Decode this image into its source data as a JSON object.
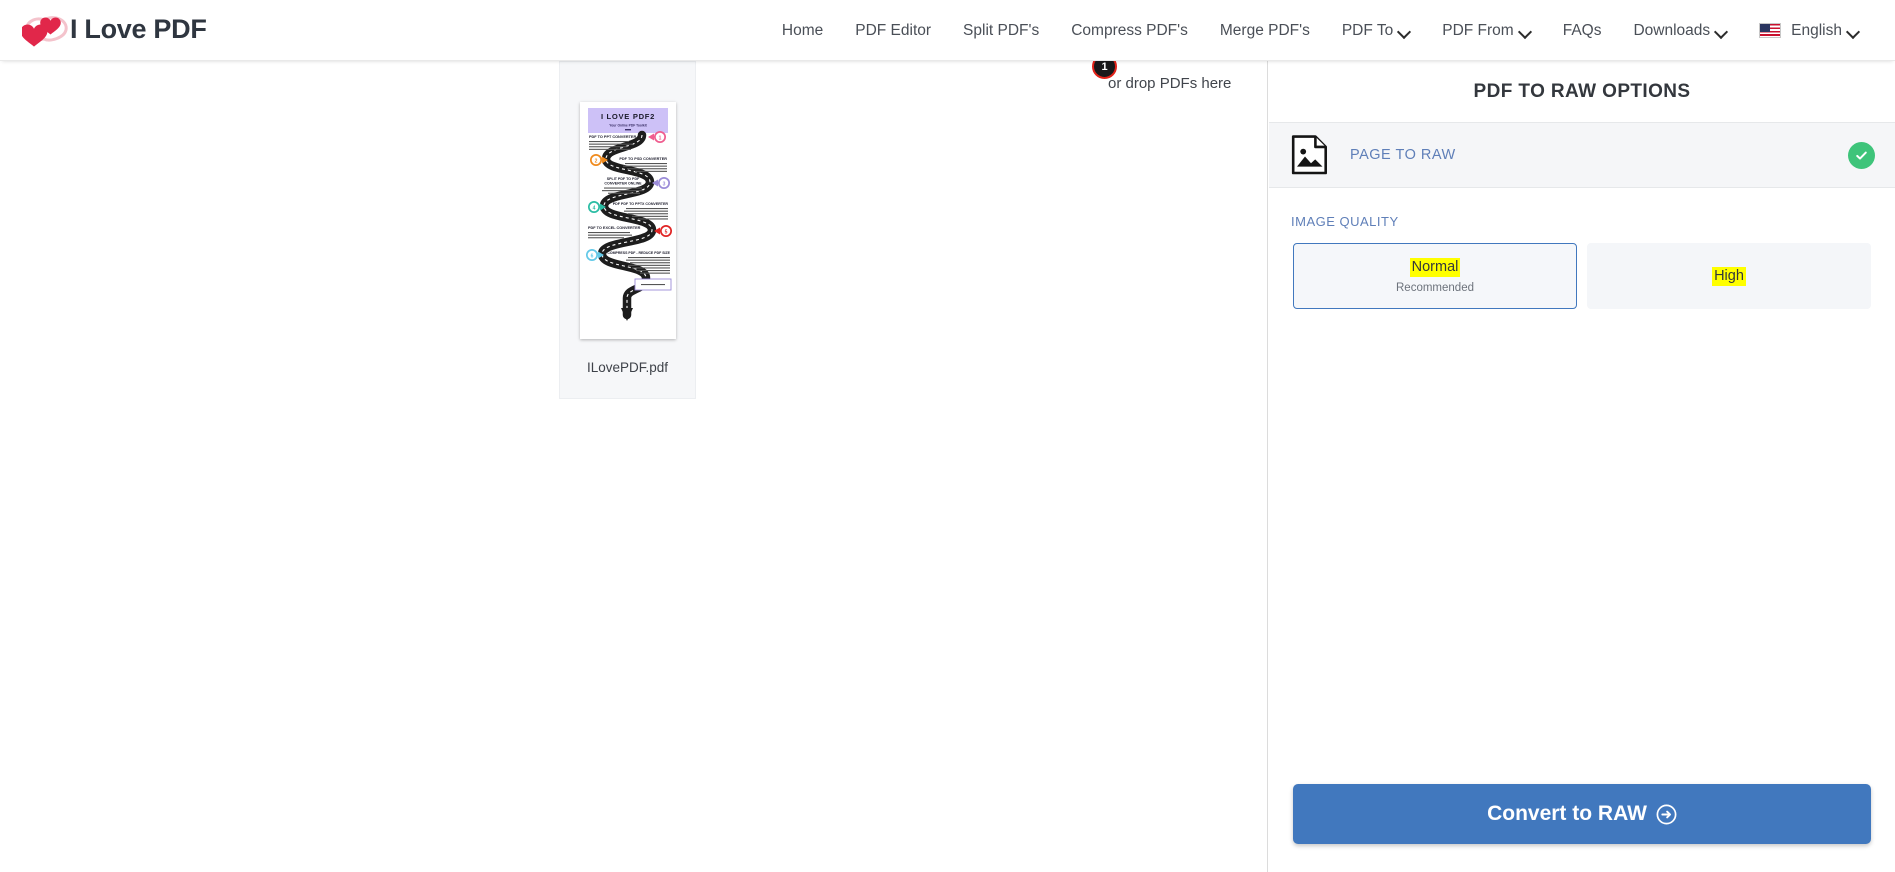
{
  "header": {
    "brand_name": "I Love PDF",
    "logo_icon": "two-hearts-logo",
    "nav": [
      {
        "label": "Home",
        "has_caret": false
      },
      {
        "label": "PDF Editor",
        "has_caret": false
      },
      {
        "label": "Split PDF's",
        "has_caret": false
      },
      {
        "label": "Compress PDF's",
        "has_caret": false
      },
      {
        "label": "Merge PDF's",
        "has_caret": false
      },
      {
        "label": "PDF To",
        "has_caret": true
      },
      {
        "label": "PDF From",
        "has_caret": true
      },
      {
        "label": "FAQs",
        "has_caret": false
      },
      {
        "label": "Downloads",
        "has_caret": true
      }
    ],
    "language": {
      "label": "English",
      "flag": "us-flag-icon",
      "has_caret": true
    }
  },
  "workspace": {
    "drop_hint": "or drop PDFs here",
    "file_count_badge": "1",
    "file": {
      "name": "ILovePDF.pdf",
      "thumbnail": {
        "title": "I LOVE PDF2",
        "subtitle": "Your Online PDF Toolkit",
        "steps": [
          {
            "number": "1",
            "heading": "PDF TO PPT CONVERTER",
            "color": "#ef5d8f"
          },
          {
            "number": "2",
            "heading": "PDF TO PSD CONVERTER",
            "color": "#f08a1c"
          },
          {
            "number": "3",
            "heading": "SPLIT PDF TO PDF CONVERTER ONLINE",
            "color": "#9b8cd8"
          },
          {
            "number": "4",
            "heading": "PDF PDF TO PPTX CONVERTER",
            "color": "#2bbda4"
          },
          {
            "number": "5",
            "heading": "PDF TO EXCEL CONVERTER",
            "color": "#e02424"
          },
          {
            "number": "6",
            "heading": "COMPRESS PDF - REDUCE PDF SIZE",
            "color": "#63c9e8"
          }
        ]
      }
    }
  },
  "panel": {
    "title": "PDF TO RAW OPTIONS",
    "tool": {
      "label": "PAGE TO RAW",
      "icon": "document-image-icon",
      "status_icon": "check-circle-icon",
      "status_color": "#3ec47a"
    },
    "image_quality": {
      "section_label": "IMAGE QUALITY",
      "options": [
        {
          "title": "Normal",
          "subtitle": "Recommended",
          "selected": true
        },
        {
          "title": "High",
          "subtitle": "",
          "selected": false
        }
      ]
    },
    "convert_button": {
      "label": "Convert to RAW",
      "icon": "arrow-right-circle-icon"
    },
    "accent_color": "#4178be",
    "highlight_color": "#ffff00"
  }
}
